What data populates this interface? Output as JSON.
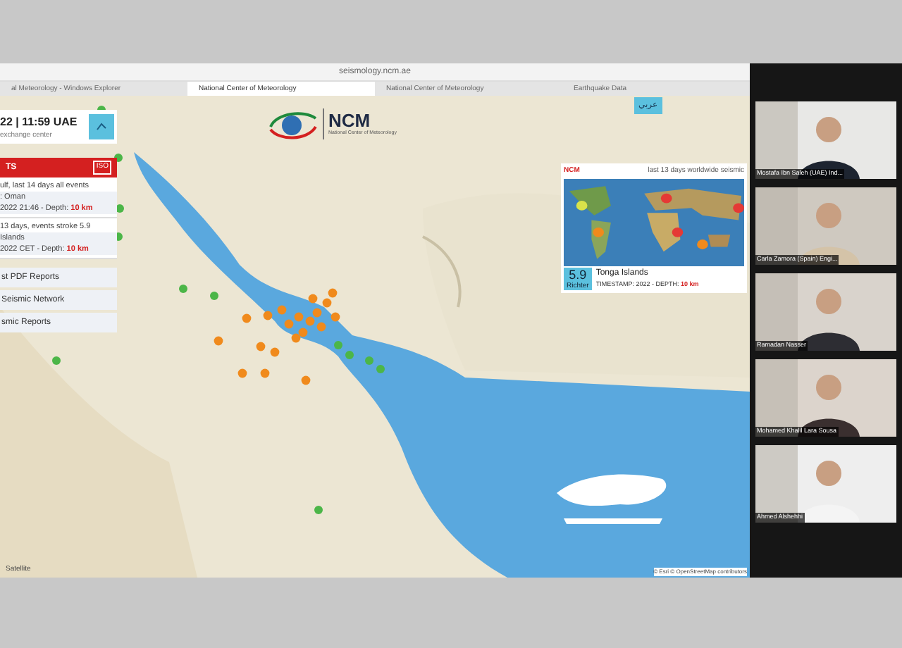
{
  "browser": {
    "address": "seismology.ncm.ae",
    "tabs": [
      {
        "label": "al Meteorology - Windows Explorer",
        "selected": false
      },
      {
        "label": "National Center of Meteorology",
        "selected": true
      },
      {
        "label": "National Center of Meteorology",
        "selected": false
      },
      {
        "label": "Earthquake Data",
        "selected": false
      }
    ]
  },
  "map": {
    "language_button": "عربي",
    "left_panel": {
      "time": "22 | 11:59 UAE",
      "subtitle": "exchange center",
      "alerts_title": "TS",
      "alerts_badge": "ISO",
      "events": [
        {
          "title": "ulf, last 14 days all events",
          "place": ": Oman",
          "info": "2022 21:46 - Depth:",
          "depth": "10 km"
        },
        {
          "title": "13 days, events stroke 5.9",
          "place": "Islands",
          "info": "2022 CET - Depth:",
          "depth": "10 km"
        }
      ],
      "links": [
        "st PDF Reports",
        "Seismic Network",
        "smic Reports"
      ]
    },
    "logo": {
      "name": "NCM",
      "subtitle": "National Center of Meteorology"
    },
    "world_panel": {
      "badge": "NCM",
      "title": "last 13 days worldwide seismic",
      "magnitude": "5.9",
      "magnitude_unit": "Richter",
      "place": "Tonga Islands",
      "info": "TIMESTAMP: 2022 - DEPTH:",
      "depth": "10 km"
    },
    "scale": "Satellite",
    "attribution": "© Esri © OpenStreetMap contributors"
  },
  "participants": [
    {
      "name": "Mostafa Ibn Saleh (UAE) Ind..."
    },
    {
      "name": "Carla Zamora (Spain) Engi..."
    },
    {
      "name": "Ramadan Nasser"
    },
    {
      "name": "Mohamed Khalil Lara Sousa"
    },
    {
      "name": "Ahmed Alshehhi"
    }
  ]
}
